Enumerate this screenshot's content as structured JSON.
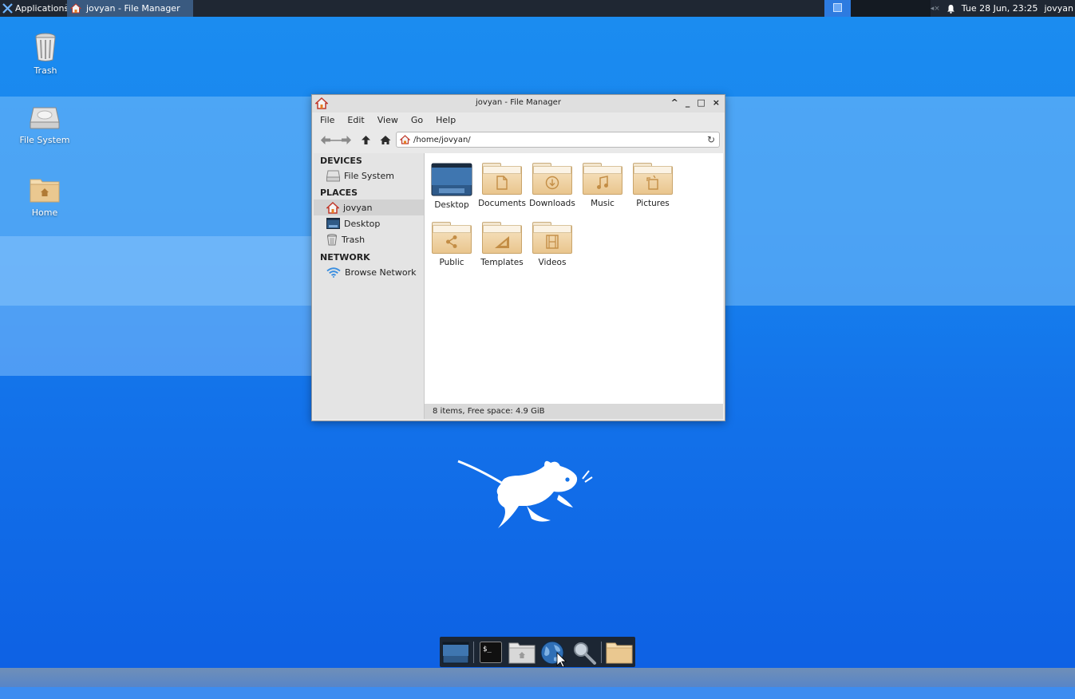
{
  "top_panel": {
    "applications_label": "Applications",
    "task_title": "jovyan - File Manager",
    "clock": "Tue 28 Jun, 23:25",
    "user": "jovyan"
  },
  "desktop_icons": [
    {
      "label": "Trash",
      "icon": "trash-icon"
    },
    {
      "label": "File System",
      "icon": "drive-icon"
    },
    {
      "label": "Home",
      "icon": "home-folder-icon"
    }
  ],
  "window": {
    "title": "jovyan - File Manager",
    "menu": [
      "File",
      "Edit",
      "View",
      "Go",
      "Help"
    ],
    "path": "/home/jovyan/",
    "sidebar": {
      "devices_header": "DEVICES",
      "devices": [
        {
          "label": "File System"
        }
      ],
      "places_header": "PLACES",
      "places": [
        {
          "label": "jovyan",
          "active": true
        },
        {
          "label": "Desktop"
        },
        {
          "label": "Trash"
        }
      ],
      "network_header": "NETWORK",
      "network": [
        {
          "label": "Browse Network"
        }
      ]
    },
    "items": [
      {
        "label": "Desktop",
        "icon": "desktop-folder-icon"
      },
      {
        "label": "Documents",
        "icon": "documents-folder-icon"
      },
      {
        "label": "Downloads",
        "icon": "downloads-folder-icon"
      },
      {
        "label": "Music",
        "icon": "music-folder-icon"
      },
      {
        "label": "Pictures",
        "icon": "pictures-folder-icon"
      },
      {
        "label": "Public",
        "icon": "public-folder-icon"
      },
      {
        "label": "Templates",
        "icon": "templates-folder-icon"
      },
      {
        "label": "Videos",
        "icon": "videos-folder-icon"
      }
    ],
    "status": "8 items, Free space: 4.9 GiB"
  },
  "dock": [
    "show-desktop-icon",
    "terminal-icon",
    "home-folder-icon",
    "web-browser-icon",
    "search-icon",
    "folder-icon"
  ],
  "colors": {
    "desktop": "#1373ea",
    "panel": "#1f2733",
    "folder": "#e9c58d"
  }
}
